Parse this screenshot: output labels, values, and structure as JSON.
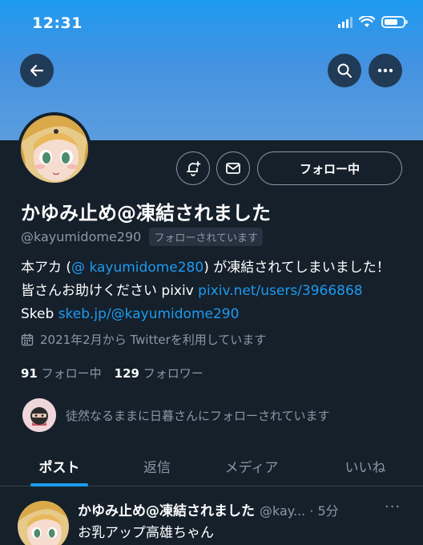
{
  "status_bar": {
    "time": "12:31"
  },
  "header": {
    "back_icon": "arrow-left-icon",
    "search_icon": "search-icon",
    "more_icon": "more-horizontal-icon"
  },
  "profile": {
    "display_name": "かゆみ止め@凍結されました",
    "handle": "@kayumidome290",
    "follows_you_badge": "フォローされています",
    "follow_button_label": "フォロー中",
    "bio": {
      "part1": "本アカ (",
      "mention": "@ kayumidome280",
      "part2": ") が凍結されてしまいました！ 皆さんお助けください pixiv ",
      "pixiv_link": "pixiv.net/users/3966868",
      "part3": " Skeb ",
      "skeb_link": "skeb.jp/@kayumidome290"
    },
    "joined": "2021年2月から Twitterを利用しています",
    "following_count": "91",
    "following_label": "フォロー中",
    "followers_count": "129",
    "followers_label": "フォロワー",
    "followed_by_text": "徒然なるままに日暮さんにフォローされています"
  },
  "tabs": [
    {
      "label": "ポスト",
      "active": true
    },
    {
      "label": "返信",
      "active": false
    },
    {
      "label": "メディア",
      "active": false
    },
    {
      "label": "いいね",
      "active": false
    }
  ],
  "tweet": {
    "name": "かゆみ止め@凍結されました",
    "handle_time": "@kay... · 5分",
    "more": "···",
    "text": "お乳アップ高雄ちゃん"
  },
  "colors": {
    "background": "#15202b",
    "accent": "#1d9bf0",
    "secondary_text": "#8b98a5"
  }
}
